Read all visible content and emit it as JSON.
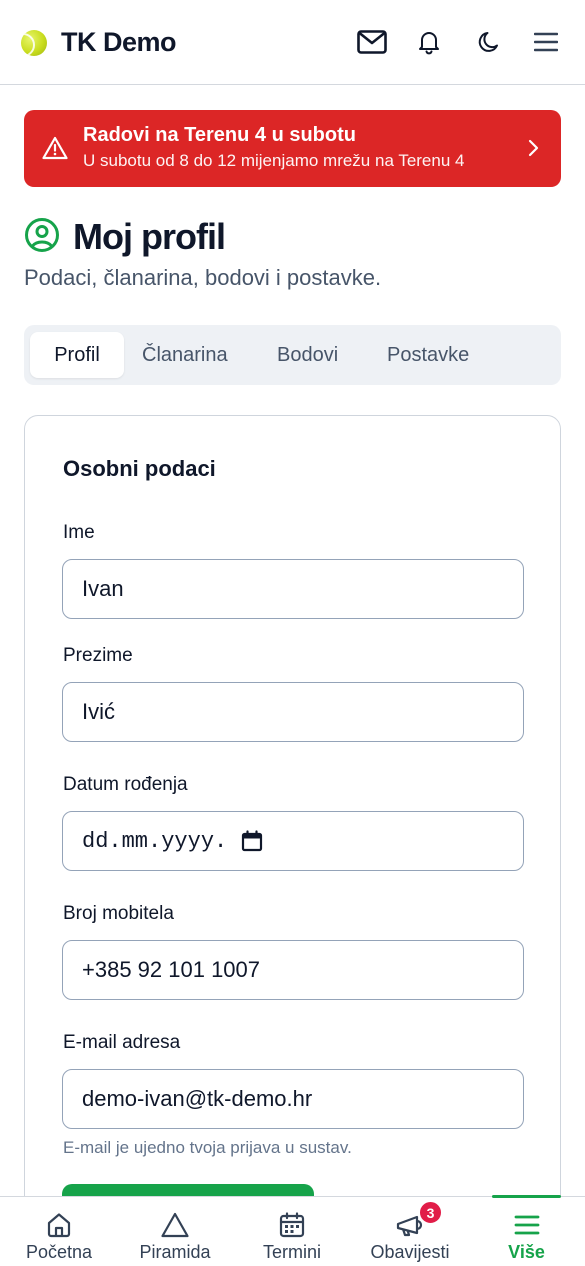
{
  "header": {
    "app_name": "TK Demo",
    "icons": [
      "tennis-ball-logo",
      "mail-icon",
      "bell-icon",
      "moon-icon",
      "menu-icon"
    ]
  },
  "alert": {
    "title": "Radovi na Terenu 4 u subotu",
    "text": "U subotu od 8 do 12 mijenjamo mrežu na Terenu 4",
    "color": "#dc2626"
  },
  "page": {
    "title": "Moj profil",
    "subtitle": "Podaci, članarina, bodovi i postavke."
  },
  "tabs": [
    {
      "label": "Profil",
      "active": true
    },
    {
      "label": "Članarina",
      "active": false
    },
    {
      "label": "Bodovi",
      "active": false
    },
    {
      "label": "Postavke",
      "active": false
    }
  ],
  "form": {
    "section_title": "Osobni podaci",
    "first_name": {
      "label": "Ime",
      "value": "Ivan"
    },
    "last_name": {
      "label": "Prezime",
      "value": "Ivić"
    },
    "birth_date": {
      "label": "Datum rođenja",
      "placeholder": "dd.mm.yyyy."
    },
    "phone": {
      "label": "Broj mobitela",
      "value": "+385 92 101 1007"
    },
    "email": {
      "label": "E-mail adresa",
      "value": "demo-ivan@tk-demo.hr",
      "hint": "E-mail je ujedno tvoja prijava u sustav."
    }
  },
  "bottom_nav": [
    {
      "label": "Početna",
      "icon": "home-icon",
      "active": false
    },
    {
      "label": "Piramida",
      "icon": "triangle-icon",
      "active": false
    },
    {
      "label": "Termini",
      "icon": "calendar-icon",
      "active": false
    },
    {
      "label": "Obavijesti",
      "icon": "megaphone-icon",
      "active": false,
      "badge": "3"
    },
    {
      "label": "Više",
      "icon": "menu-icon",
      "active": true
    }
  ],
  "colors": {
    "accent": "#16a34a",
    "danger": "#dc2626",
    "badge": "#e11d48"
  }
}
